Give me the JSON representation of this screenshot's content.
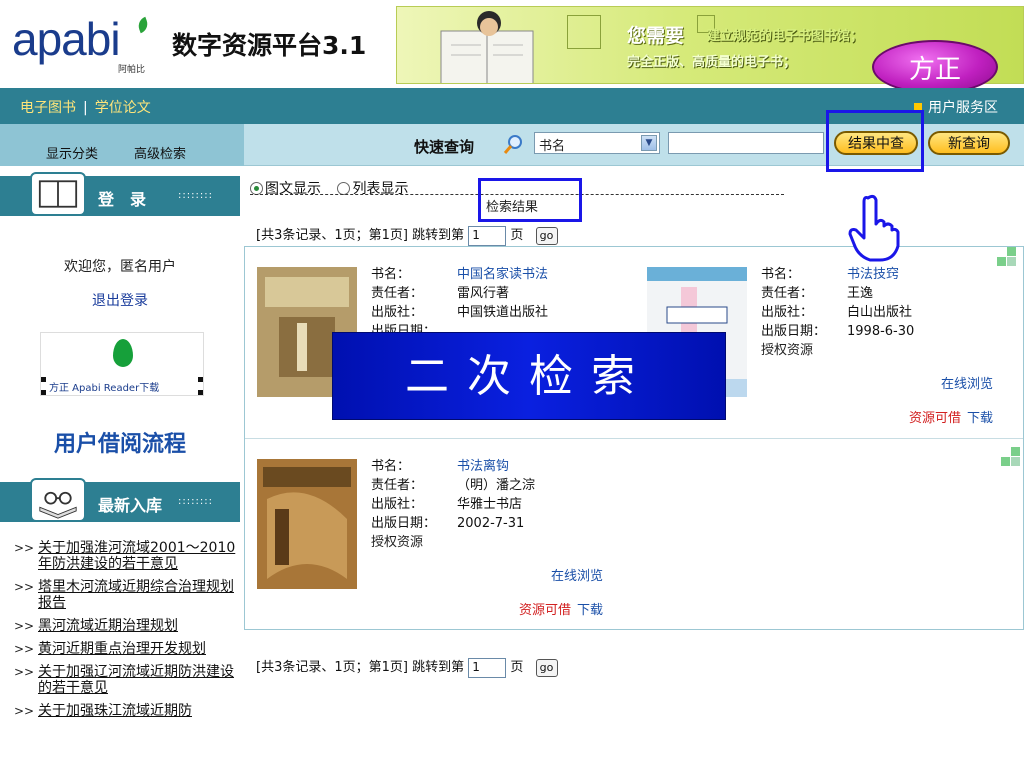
{
  "header": {
    "logo_text": "apabi",
    "logo_subtext": "阿帕比",
    "platform_title": "数字资源平台3.1",
    "banner": {
      "main": "您需要",
      "line1": "建立规范的电子书图书馆；",
      "line2": "完全正版、高质量的电子书；"
    },
    "founder_badge": "方正"
  },
  "nav": {
    "left_items": [
      "电子图书",
      "学位论文"
    ],
    "right_item": "用户服务区"
  },
  "toolbar": {
    "side_tabs": [
      "显示分类",
      "高级检索"
    ],
    "quick_label": "快速查询",
    "field_select": "书名",
    "search_value": "",
    "btn_in_results": "结果中查",
    "btn_new_query": "新查询"
  },
  "sidebar": {
    "login_title": "登　录",
    "dots": "::::::::",
    "welcome": "欢迎您，匿名用户",
    "logout": "退出登录",
    "reader_label": "方正 Apabi Reader下载",
    "borrow_flow": "用户借阅流程",
    "new_title": "最新入库",
    "news": [
      "关于加强淮河流域2001～2010年防洪建设的若干意见",
      "塔里木河流域近期综合治理规划报告",
      "黑河流域近期治理规划",
      "黄河近期重点治理开发规划",
      "关于加强辽河流域近期防洪建设的若干意见",
      "关于加强珠江流域近期防"
    ]
  },
  "main": {
    "view_graphic": "图文显示",
    "view_list": "列表显示",
    "results_title": "检索结果",
    "pager": {
      "text": "[共3条记录、1页；第1页] 跳转到第",
      "page_value": "1",
      "page_suffix": "页",
      "go": "go"
    },
    "labels": {
      "title": "书名：",
      "author": "责任者：",
      "publisher": "出版社：",
      "date": "出版日期：",
      "rights": "授权资源"
    },
    "books": [
      {
        "title": "中国名家读书法",
        "author": "雷风行著",
        "publisher": "中国铁道出版社",
        "date": "",
        "rights": "",
        "online": "",
        "available": "",
        "download": "",
        "cover_color": "#a89060"
      },
      {
        "title": "书法技窍",
        "author": "王逸",
        "publisher": "白山出版社",
        "date": "1998-6-30",
        "rights": "授权资源",
        "online": "在线浏览",
        "available": "资源可借",
        "download": "下载",
        "cover_color": "#f2f4f6"
      },
      {
        "title": "书法离钩",
        "author": "（明）潘之淙",
        "publisher": "华雅士书店",
        "date": "2002-7-31",
        "rights": "授权资源",
        "online": "在线浏览",
        "available": "资源可借",
        "download": "下载",
        "cover_color": "#a87638"
      }
    ]
  },
  "overlay_text": "二次检索",
  "colors": {
    "nav_bg": "#2d7f92",
    "highlight": "#1a16e8",
    "overlay_bg": "#0a20e0",
    "link": "#1a4fa8",
    "available": "#d22020"
  }
}
